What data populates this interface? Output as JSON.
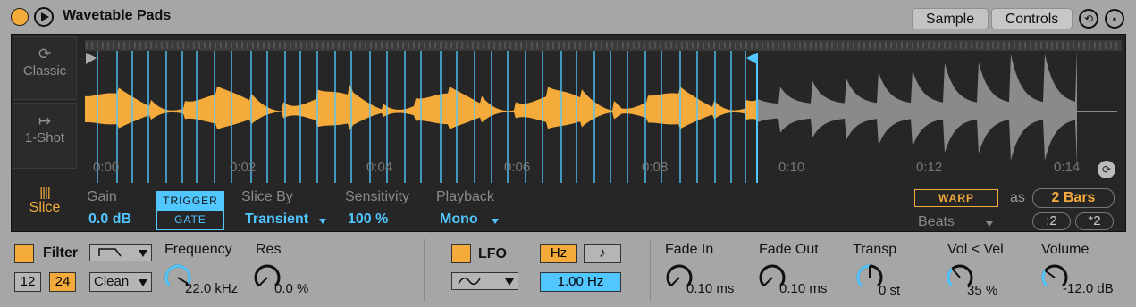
{
  "header": {
    "title": "Wavetable Pads",
    "tabs": {
      "sample": "Sample",
      "controls": "Controls"
    }
  },
  "modes": {
    "classic": "Classic",
    "one_shot": "1-Shot",
    "slice": "Slice"
  },
  "timeline": [
    "0:00",
    "0:02",
    "0:04",
    "0:06",
    "0:08",
    "0:10",
    "0:12",
    "0:14"
  ],
  "controls": {
    "gain": {
      "label": "Gain",
      "value": "0.0 dB"
    },
    "trigger": {
      "top": "TRIGGER",
      "bottom": "GATE"
    },
    "slice_by": {
      "label": "Slice By",
      "value": "Transient"
    },
    "sensitivity": {
      "label": "Sensitivity",
      "value": "100 %"
    },
    "playback": {
      "label": "Playback",
      "value": "Mono"
    },
    "warp": {
      "label": "WARP",
      "as": "as",
      "bars": "2 Bars",
      "mode": "Beats",
      "half": ":2",
      "double": "*2"
    }
  },
  "filter": {
    "label": "Filter",
    "slope12": "12",
    "slope24": "24",
    "circuit": "Clean",
    "frequency": {
      "label": "Frequency",
      "value": "22.0 kHz",
      "level": 0.95
    },
    "res": {
      "label": "Res",
      "value": "0.0 %",
      "level": 0.0
    }
  },
  "lfo": {
    "label": "LFO",
    "hz": "Hz",
    "note": "♪",
    "rate": "1.00 Hz"
  },
  "env": {
    "fade_in": {
      "label": "Fade In",
      "value": "0.10 ms",
      "level": 0.0
    },
    "fade_out": {
      "label": "Fade Out",
      "value": "0.10 ms",
      "level": 0.0
    },
    "transp": {
      "label": "Transp",
      "value": "0 st",
      "level": 0.5
    },
    "vol_vel": {
      "label": "Vol < Vel",
      "value": "35 %",
      "level": 0.35
    },
    "volume": {
      "label": "Volume",
      "value": "-12.0 dB",
      "level": 0.3
    }
  },
  "colors": {
    "accent_orange": "#f5ab3c",
    "accent_blue": "#51c6ff",
    "panel": "#262626",
    "body": "#a6a6a6"
  }
}
